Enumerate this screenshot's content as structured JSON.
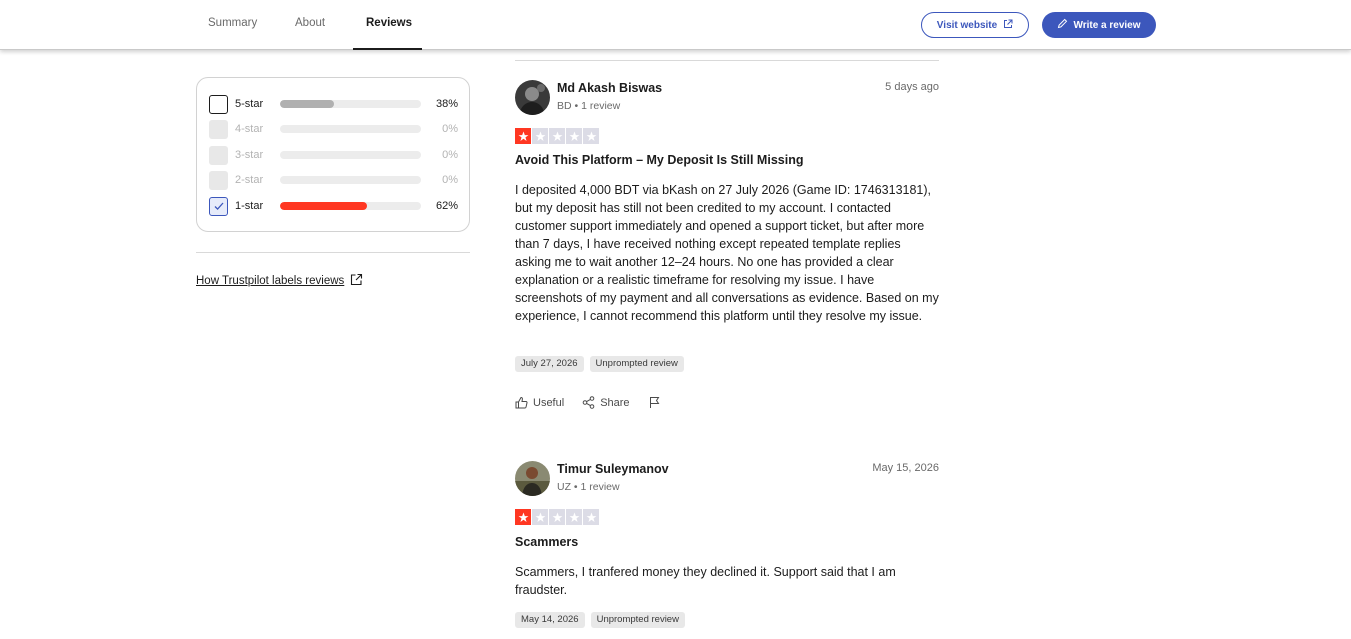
{
  "nav": {
    "tabs": [
      {
        "label": "Summary",
        "active": false
      },
      {
        "label": "About",
        "active": false
      },
      {
        "label": "Reviews",
        "active": true
      }
    ],
    "visit_label": "Visit website",
    "write_label": "Write a review"
  },
  "filters": [
    {
      "label": "5-star",
      "percent": "38%",
      "value": 38,
      "enabled": true,
      "checked": false,
      "color": "#b0b0b0"
    },
    {
      "label": "4-star",
      "percent": "0%",
      "value": 0,
      "enabled": false,
      "checked": false,
      "color": "#b0b0b0"
    },
    {
      "label": "3-star",
      "percent": "0%",
      "value": 0,
      "enabled": false,
      "checked": false,
      "color": "#b0b0b0"
    },
    {
      "label": "2-star",
      "percent": "0%",
      "value": 0,
      "enabled": false,
      "checked": false,
      "color": "#b0b0b0"
    },
    {
      "label": "1-star",
      "percent": "62%",
      "value": 62,
      "enabled": true,
      "checked": true,
      "color": "#ff3722"
    }
  ],
  "labels_link": "How Trustpilot labels reviews",
  "colors": {
    "accent": "#3c57bc",
    "star_on": "#ff3722",
    "star_off": "#dcdce6"
  },
  "reviews": [
    {
      "name": "Md Akash Biswas",
      "meta": "BD • 1 review",
      "date": "5 days ago",
      "rating": 1,
      "title": "Avoid This Platform – My Deposit Is Still Missing",
      "body": "I deposited 4,000 BDT via bKash on 27 July 2026 (Game ID: 1746313181), but my deposit has still not been credited to my account. I contacted customer support immediately and opened a support ticket, but after more than 7 days, I have received nothing except repeated template replies asking me to wait another 12–24 hours. No one has provided a clear explanation or a realistic timeframe for resolving my issue. I have screenshots of my payment and all conversations as evidence. Based on my experience, I cannot recommend this platform until they resolve my issue.",
      "tags": [
        "July 27, 2026",
        "Unprompted review"
      ],
      "useful_label": "Useful",
      "share_label": "Share"
    },
    {
      "name": "Timur Suleymanov",
      "meta": "UZ • 1 review",
      "date": "May 15, 2026",
      "rating": 1,
      "title": "Scammers",
      "body": "Scammers, I tranfered money they declined it. Support said that I am fraudster.",
      "tags": [
        "May 14, 2026",
        "Unprompted review"
      ]
    }
  ]
}
